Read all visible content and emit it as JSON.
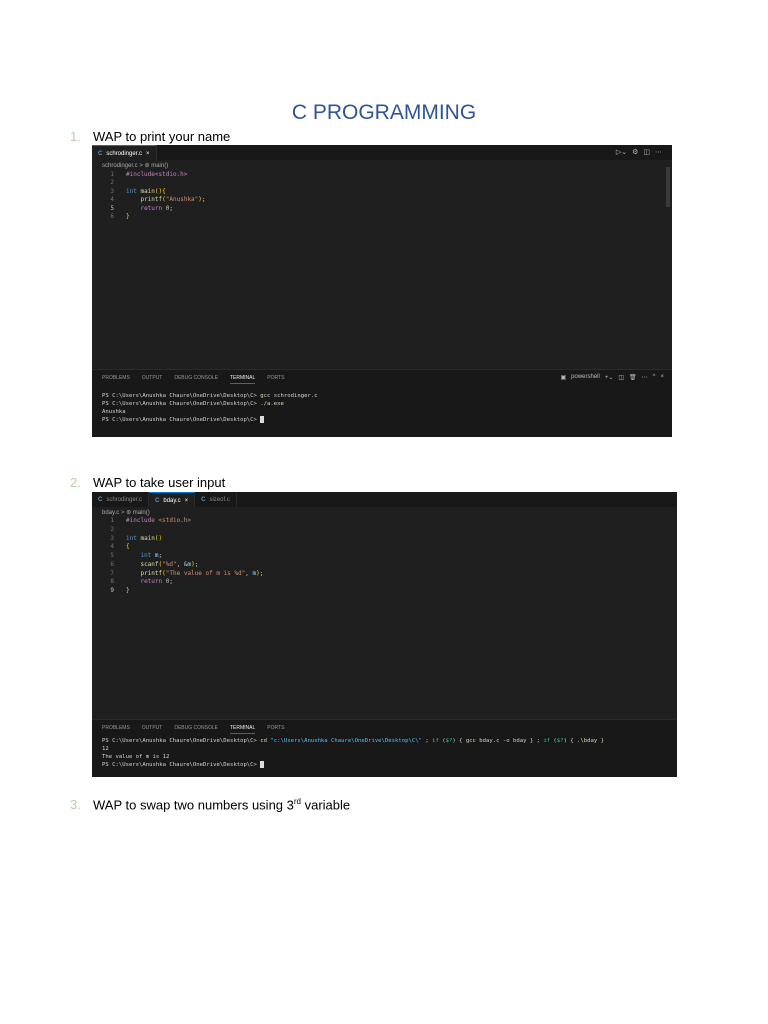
{
  "title": "C PROGRAMMING",
  "items": [
    {
      "num": "1.",
      "text": "WAP to print your name"
    },
    {
      "num": "2.",
      "text": "WAP to take user input"
    },
    {
      "num": "3.",
      "text": "WAP to swap two numbers using 3",
      "sup": "rd",
      "tail": " variable"
    }
  ],
  "shot1": {
    "tabs": [
      {
        "label": "schrodinger.c",
        "active": true,
        "close": "×"
      }
    ],
    "breadcrumb": "schrodinger.c > ⊛ main()",
    "code": [
      [
        [
          "pre",
          "#include<stdio.h>"
        ]
      ],
      [],
      [
        [
          "kw",
          "int "
        ],
        [
          "fn",
          "main"
        ],
        [
          "br",
          "(){"
        ]
      ],
      [
        [
          "pl",
          "    "
        ],
        [
          "fn",
          "printf"
        ],
        [
          "br",
          "("
        ],
        [
          "str",
          "\"Anushka\""
        ],
        [
          "br",
          ")"
        ],
        [
          "pl",
          ";"
        ]
      ],
      [
        [
          "pl",
          "    "
        ],
        [
          "ctl",
          "return "
        ],
        [
          "num",
          "0"
        ],
        [
          "pl",
          ";"
        ]
      ],
      [
        [
          "br",
          "}"
        ]
      ]
    ],
    "panel_tabs": [
      "PROBLEMS",
      "OUTPUT",
      "DEBUG CONSOLE",
      "TERMINAL",
      "PORTS"
    ],
    "terminal_label": "powershell",
    "terminal": [
      [
        [
          "pl",
          "PS C:\\Users\\Anushka Chaure\\OneDrive\\Desktop\\C> "
        ],
        [
          "y",
          "gcc"
        ],
        [
          "pl",
          " schrodinger.c"
        ]
      ],
      [
        [
          "pl",
          "PS C:\\Users\\Anushka Chaure\\OneDrive\\Desktop\\C> "
        ],
        [
          "y",
          "./a.exe"
        ]
      ],
      [
        [
          "pl",
          "Anushka"
        ]
      ],
      [
        [
          "pl",
          "PS C:\\Users\\Anushka Chaure\\OneDrive\\Desktop\\C> "
        ]
      ]
    ]
  },
  "shot2": {
    "tabs": [
      {
        "label": "schrodinger.c",
        "active": false,
        "close": ""
      },
      {
        "label": "bday.c",
        "active": true,
        "close": "×"
      },
      {
        "label": "sizeof.c",
        "active": false,
        "close": ""
      }
    ],
    "breadcrumb": "bday.c > ⊛ main()",
    "code": [
      [
        [
          "pre",
          "#include "
        ],
        [
          "str",
          "<stdio.h>"
        ]
      ],
      [],
      [
        [
          "kw",
          "int "
        ],
        [
          "fn",
          "main"
        ],
        [
          "br",
          "()"
        ]
      ],
      [
        [
          "br",
          "{"
        ]
      ],
      [
        [
          "pl",
          "    "
        ],
        [
          "kw",
          "int "
        ],
        [
          "var",
          "m"
        ],
        [
          "pl",
          ";"
        ]
      ],
      [
        [
          "pl",
          "    "
        ],
        [
          "fn",
          "scanf"
        ],
        [
          "br",
          "("
        ],
        [
          "str",
          "\"%d\""
        ],
        [
          "pl",
          ", &"
        ],
        [
          "var",
          "m"
        ],
        [
          "br",
          ")"
        ],
        [
          "pl",
          ";"
        ]
      ],
      [
        [
          "pl",
          "    "
        ],
        [
          "fn",
          "printf"
        ],
        [
          "br",
          "("
        ],
        [
          "str",
          "\"The value of m is %d\""
        ],
        [
          "pl",
          ", "
        ],
        [
          "var",
          "m"
        ],
        [
          "br",
          ")"
        ],
        [
          "pl",
          ";"
        ]
      ],
      [
        [
          "pl",
          "    "
        ],
        [
          "ctl",
          "return "
        ],
        [
          "num",
          "0"
        ],
        [
          "pl",
          ";"
        ]
      ],
      [
        [
          "br",
          "}"
        ]
      ]
    ],
    "panel_tabs": [
      "PROBLEMS",
      "OUTPUT",
      "DEBUG CONSOLE",
      "TERMINAL",
      "PORTS"
    ],
    "terminal": [
      [
        [
          "pl",
          "PS C:\\Users\\Anushka Chaure\\OneDrive\\Desktop\\C> "
        ],
        [
          "y",
          "cd"
        ],
        [
          "cy",
          " \"c:\\Users\\Anushka Chaure\\OneDrive\\Desktop\\C\\\""
        ],
        [
          "pl",
          " ; "
        ],
        [
          "gr",
          "if"
        ],
        [
          "pl",
          " ("
        ],
        [
          "gr",
          "$?"
        ],
        [
          "pl",
          ") { "
        ],
        [
          "y",
          "gcc"
        ],
        [
          "pl",
          " bday.c "
        ],
        [
          "pl",
          "-o"
        ],
        [
          "pl",
          " bday } ; "
        ],
        [
          "gr",
          "if"
        ],
        [
          "pl",
          " ("
        ],
        [
          "gr",
          "$?"
        ],
        [
          "pl",
          ") { "
        ],
        [
          "y",
          ".\\bday"
        ],
        [
          "pl",
          " }"
        ]
      ],
      [
        [
          "pl",
          "12"
        ]
      ],
      [
        [
          "pl",
          "The value of m is 12"
        ]
      ],
      [
        [
          "pl",
          "PS C:\\Users\\Anushka Chaure\\OneDrive\\Desktop\\C> "
        ]
      ]
    ]
  }
}
